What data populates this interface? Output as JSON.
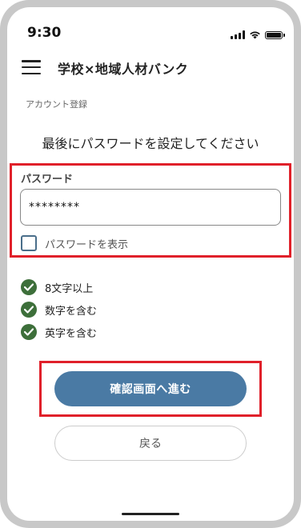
{
  "status_bar": {
    "time": "9:30"
  },
  "header": {
    "title": "学校×地域人材バンク"
  },
  "breadcrumb": "アカウント登録",
  "heading": "最後にパスワードを設定してください",
  "password": {
    "label": "パスワード",
    "value": "********",
    "show_label": "パスワードを表示",
    "show_checked": false
  },
  "rules": [
    {
      "label": "8文字以上",
      "met": true
    },
    {
      "label": "数字を含む",
      "met": true
    },
    {
      "label": "英字を含む",
      "met": true
    }
  ],
  "buttons": {
    "confirm_label": "確認画面へ進む",
    "back_label": "戻る"
  },
  "colors": {
    "primary": "#4a7aa4",
    "check": "#3d6f3a",
    "highlight": "#e0202a"
  },
  "icons": [
    "menu-icon",
    "signal-icon",
    "wifi-icon",
    "battery-icon",
    "check-circle-icon"
  ]
}
